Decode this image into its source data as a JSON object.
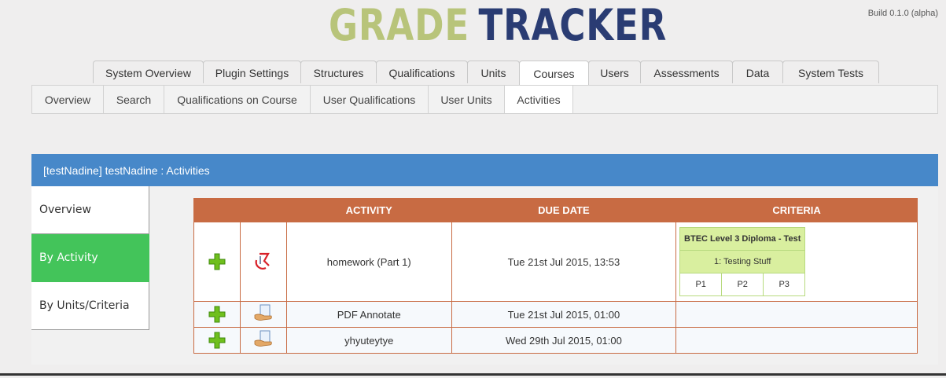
{
  "header": {
    "logo_left": "GRADE",
    "logo_right": "TRACKER",
    "build": "Build 0.1.0 (alpha)"
  },
  "tabs": [
    {
      "label": "System Overview",
      "active": false
    },
    {
      "label": "Plugin Settings",
      "active": false
    },
    {
      "label": "Structures",
      "active": false
    },
    {
      "label": "Qualifications",
      "active": false
    },
    {
      "label": "Units",
      "active": false
    },
    {
      "label": "Courses",
      "active": true
    },
    {
      "label": "Users",
      "active": false
    },
    {
      "label": "Assessments",
      "active": false
    },
    {
      "label": "Data",
      "active": false
    },
    {
      "label": "System Tests",
      "active": false
    }
  ],
  "subnav": [
    {
      "label": "Overview",
      "active": false
    },
    {
      "label": "Search",
      "active": false
    },
    {
      "label": "Qualifications on Course",
      "active": false
    },
    {
      "label": "User Qualifications",
      "active": false
    },
    {
      "label": "User Units",
      "active": false
    },
    {
      "label": "Activities",
      "active": true
    }
  ],
  "panel": {
    "title": "[testNadine] testNadine : Activities"
  },
  "sidemenu": [
    {
      "label": "Overview",
      "active": false
    },
    {
      "label": "By Activity",
      "active": true
    },
    {
      "label": "By Units/Criteria",
      "active": false
    }
  ],
  "table": {
    "headers": [
      "",
      "",
      "ACTIVITY",
      "DUE DATE",
      "CRITERIA"
    ],
    "rows": [
      {
        "add_icon": "plus-icon",
        "type_icon": "turnitin-icon",
        "activity": "homework (Part 1)",
        "due": "Tue 21st Jul 2015, 13:53",
        "criteria": {
          "qualification": "BTEC Level 3 Diploma - Test",
          "unit": "1: Testing Stuff",
          "criteria": [
            "P1",
            "P2",
            "P3"
          ]
        }
      },
      {
        "add_icon": "plus-icon",
        "type_icon": "assignment-icon",
        "activity": "PDF Annotate",
        "due": "Tue 21st Jul 2015, 01:00"
      },
      {
        "add_icon": "plus-icon",
        "type_icon": "assignment-icon",
        "activity": "yhyuteytye",
        "due": "Wed 29th Jul 2015, 01:00"
      }
    ]
  },
  "colors": {
    "accent_blue": "#4788c9",
    "table_header": "#c86b43",
    "active_side": "#43c45a",
    "criteria_bg": "#d9ef9f"
  }
}
